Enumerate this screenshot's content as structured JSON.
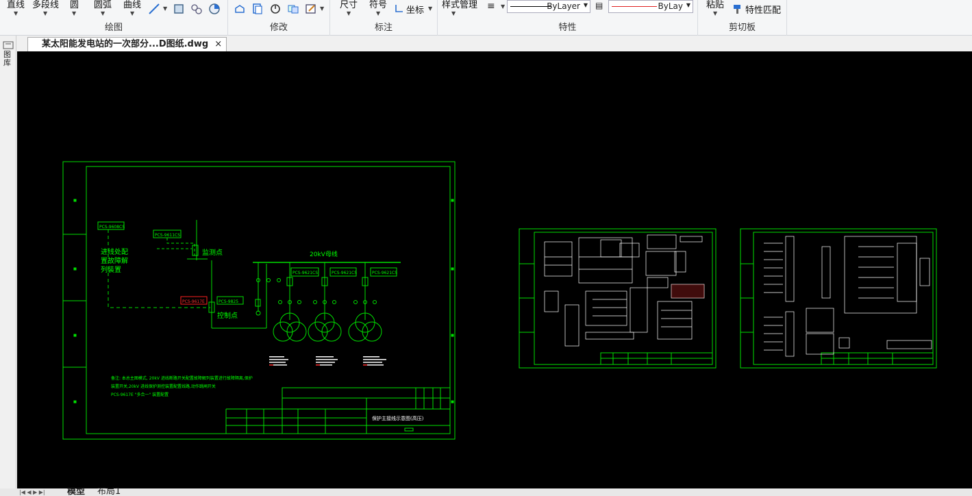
{
  "ribbon": {
    "draw": {
      "line": "直线",
      "polyline": "多段线",
      "circle": "圆",
      "arc": "圆弧",
      "curve": "曲线",
      "title": "绘图"
    },
    "modify": {
      "title": "修改"
    },
    "annotate": {
      "dimension": "尺寸",
      "symbol": "符号",
      "coordinate": "坐标",
      "title": "标注"
    },
    "properties": {
      "style_manager": "样式管理",
      "linetype": "ByLayer",
      "color": "ByLay",
      "title": "特性"
    },
    "clipboard": {
      "paste": "粘贴",
      "match_properties": "特性匹配",
      "title": "剪切板"
    }
  },
  "sidebar": {
    "label": "图库"
  },
  "document_tab": {
    "title": "某太阳能发电站的一次部分...D图纸.dwg",
    "close": "×"
  },
  "drawing": {
    "left_texts": [
      "PCS-9608CS",
      "PCS-9611CS",
      "PCS-9617E",
      "PCS-9825"
    ],
    "note_line1": "进线处配",
    "note_line2": "置故障解",
    "note_line3": "列装置",
    "monitor_point": "监测点",
    "control_point": "控制点",
    "bus_label": "20kV母线",
    "feeders": [
      "PCS-9621CS",
      "PCS-9621CS",
      "PCS-9621CS"
    ],
    "tb_title": "保护主接线示意图(高压)",
    "notes": [
      "备注: 本总主图模式, 20kV 进线断路开关配置故障解列装置进行故障隔离,保护",
      "装置开关,20kV 进线保护测控装置配置线路,动作跳闸开关",
      "PCS-9617E \"多合一\" 装置配置"
    ]
  },
  "layout_tabs": {
    "model": "模型",
    "layout1": "布局1"
  },
  "colors": {
    "canvas": "#000000",
    "frame": "#00ff00",
    "highlight": "#ff2020"
  }
}
